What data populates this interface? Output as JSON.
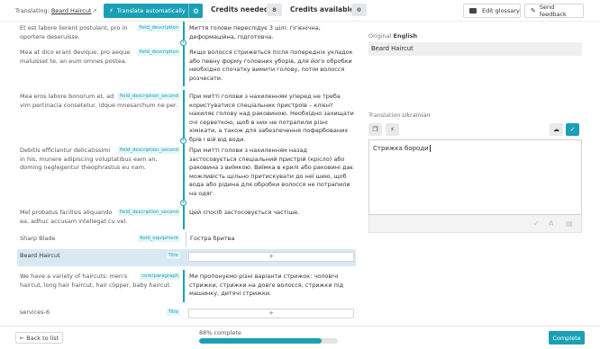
{
  "header": {
    "translating_label": "Translating:",
    "doc_link": "Beard Haircut",
    "auto_button": "Translate automatically",
    "credits_needed_label": "Credits needed",
    "credits_needed_value": "8",
    "credits_available_label": "Credits available",
    "credits_available_value": "0",
    "glossary_button": "Edit glossary",
    "feedback_button": "Send feedback"
  },
  "rows": [
    {
      "source": "Et est labore lierent postulant, pro in oportere deseruisse.",
      "tag": "field_description",
      "target": "Миття голови переслідує 3 цілі: гігієнічна, деформаційна, підготовча."
    },
    {
      "source": "Mea at dico erant devique, pro aeque maluisset te, an eum omnes postea.",
      "tag": "field_description",
      "target": "Якщо волосся стрижеться після попередніх укладок або певну форму головних уборів, для його обробки необхідно спочатку вимити голову, потім волосся розчесати."
    },
    {
      "source": "Mea eros labore bonorum et, ad vim pertinacia consetetur, idque mnesarchum ne per.",
      "tag": "field_description_second",
      "target": "При митті голови з нахиленням уперед не треба користуватися спеціальних пристроїв – клієнт нахиляє голову над раковиною. Необхідно захищати очі серветкою, щоб в них не потрапили різні хімікати, а також для забезпечення пофарбованих брів і вій від води."
    },
    {
      "source": "Debitis efficiantur delicatissimi in his, munere adipiscing voluptatibus eam an, doming neglegentur theophrastus eu nam.",
      "tag": "field_description_second",
      "target": "При митті голови з нахиленням назад застосовується спеціальний пристрій (крісло) або раковина з виїмкою. Виїмка в крилі або раковині дає можливість щільно притискувати до неї шию, щоб вода або рідина для обробки волосся не потрапили на одяг."
    },
    {
      "source": "Mel probatus facilisis aliquando ea, adhuc accusam intellegat cu vel.",
      "tag": "field_description_second",
      "target": "Цей спосіб застосовується частіше."
    },
    {
      "source": "Sharp Blade",
      "tag": "field_equipment",
      "target": "Гостра бритва"
    },
    {
      "source": "Beard Haircut",
      "tag": "Title",
      "target": ""
    },
    {
      "source": "We have a variety of haircuts: men's haircut, long hair haircut, hair clipper, baby haircut.",
      "tag": "core/paragraph",
      "target": "Ми пропонуємо різні варіанти стрижок: чоловічі стрижки, стрижки на довге волосся, стрижки під машинку, дитячі стрижки."
    },
    {
      "source": "services-6",
      "tag": "Title",
      "target": ""
    }
  ],
  "editor": {
    "original_label": "Original",
    "original_lang": "English",
    "original_text": "Beard Haircut",
    "translation_label": "Translation",
    "translation_lang": "Ukrainian",
    "translation_text": "Стрижка бороди"
  },
  "footer": {
    "back_button": "← Back to list",
    "progress_label": "88% complete",
    "progress_value": 0.88,
    "complete_button": "Complete"
  },
  "icons": {
    "copy": "copy-icon",
    "bolt": "bolt-icon",
    "cloud_download": "cloud-download-icon",
    "check": "check-icon",
    "external_link": "external-link-icon",
    "gear": "gear-icon",
    "glossary": "glossary-icon",
    "feedback": "pencil-icon"
  },
  "colors": {
    "accent": "#1aa0b6",
    "selected_row": "#d8e9f2"
  }
}
